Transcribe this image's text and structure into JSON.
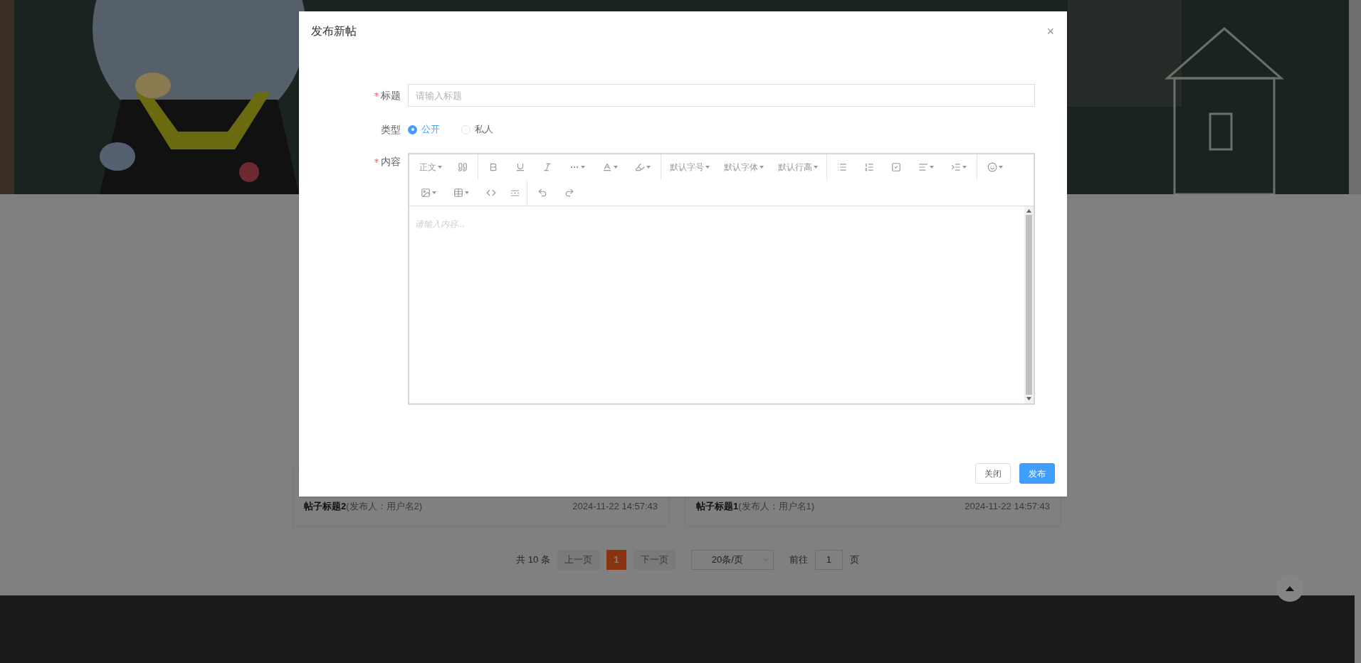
{
  "dialog": {
    "title": "发布新帖",
    "close": "×",
    "fields": {
      "title": {
        "label": "标题",
        "required": true,
        "placeholder": "请输入标题"
      },
      "type": {
        "label": "类型",
        "options": [
          {
            "label": "公开",
            "selected": true
          },
          {
            "label": "私人",
            "selected": false
          }
        ]
      },
      "content": {
        "label": "内容",
        "required": true,
        "placeholder": "请输入内容...",
        "toolbar_texts": [
          "正文",
          "默认字号",
          "默认字体",
          "默认行高"
        ]
      }
    },
    "buttons": [
      {
        "label": "关闭",
        "kind": "default"
      },
      {
        "label": "发布",
        "kind": "primary"
      }
    ]
  },
  "posts": [
    {
      "title": "帖子标题2",
      "author": "(发布人：用户名2)",
      "time": "2024-11-22 14:57:43"
    },
    {
      "title": "帖子标题1",
      "author": "(发布人：用户名1)",
      "time": "2024-11-22 14:57:43"
    }
  ],
  "pagination": {
    "total": "共 10 条",
    "prev": "上一页",
    "pages": [
      {
        "label": "1",
        "selected": true
      }
    ],
    "next": "下一页",
    "page_size": "20条/页",
    "goto": "前往",
    "goto_value": "1",
    "page_unit": "页"
  }
}
